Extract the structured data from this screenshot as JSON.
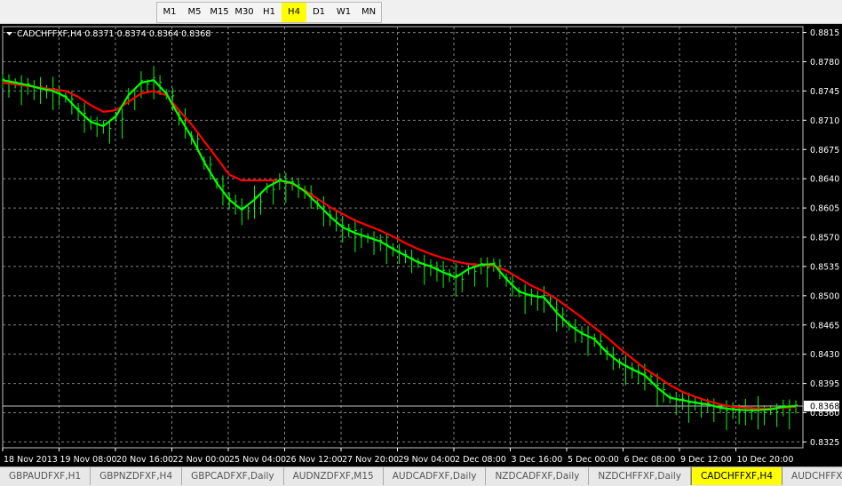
{
  "toolbar": {
    "timeframes": [
      {
        "label": "M1",
        "active": false
      },
      {
        "label": "M5",
        "active": false
      },
      {
        "label": "M15",
        "active": false
      },
      {
        "label": "M30",
        "active": false
      },
      {
        "label": "H1",
        "active": false
      },
      {
        "label": "H4",
        "active": true
      },
      {
        "label": "D1",
        "active": false
      },
      {
        "label": "W1",
        "active": false
      },
      {
        "label": "MN",
        "active": false
      }
    ]
  },
  "chart": {
    "header": "CADCHFFXF,H4  0.8371 0.8374 0.8364 0.8368",
    "current_price": "0.8368",
    "colors": {
      "background": "#000000",
      "grid": "#808080",
      "bars": "#00ff00",
      "ma_fast": "#00ff00",
      "ma_slow": "#ff0000",
      "price_line": "#c0c0c0"
    }
  },
  "chart_data": {
    "type": "line",
    "y_ticks": [
      "0.8815",
      "0.8780",
      "0.8745",
      "0.8710",
      "0.8675",
      "0.8640",
      "0.8605",
      "0.8570",
      "0.8535",
      "0.8500",
      "0.8465",
      "0.8430",
      "0.8395",
      "0.8360",
      "0.8325"
    ],
    "x_ticks": [
      "18 Nov 2013",
      "19 Nov 08:00",
      "20 Nov 16:00",
      "22 Nov 00:00",
      "25 Nov 04:00",
      "26 Nov 12:00",
      "27 Nov 20:00",
      "29 Nov 04:00",
      "2 Dec 08:00",
      "3 Dec 16:00",
      "5 Dec 00:00",
      "6 Dec 08:00",
      "9 Dec 12:00",
      "10 Dec 20:00"
    ],
    "ylim": [
      0.8318,
      0.8822
    ],
    "grid": true,
    "series": [
      {
        "values": [
          0.8758,
          0.8755,
          0.8752,
          0.8748,
          0.8745,
          0.8738,
          0.8722,
          0.8708,
          0.8703,
          0.8715,
          0.874,
          0.8755,
          0.8758,
          0.8742,
          0.8715,
          0.869,
          0.866,
          0.8635,
          0.8615,
          0.8603,
          0.8615,
          0.863,
          0.8638,
          0.8635,
          0.8625,
          0.861,
          0.8595,
          0.8582,
          0.8575,
          0.857,
          0.8565,
          0.8556,
          0.8548,
          0.854,
          0.8535,
          0.8528,
          0.8522,
          0.8532,
          0.8537,
          0.8538,
          0.852,
          0.8505,
          0.85,
          0.8498,
          0.848,
          0.8465,
          0.8455,
          0.8448,
          0.8432,
          0.842,
          0.8412,
          0.8405,
          0.839,
          0.8378,
          0.8375,
          0.8372,
          0.837,
          0.8366,
          0.8364,
          0.8363,
          0.8363,
          0.8364,
          0.8367,
          0.8368
        ]
      },
      {
        "values": [
          0.8755,
          0.8753,
          0.8751,
          0.8749,
          0.8747,
          0.8745,
          0.8738,
          0.8728,
          0.872,
          0.8722,
          0.8732,
          0.8742,
          0.8745,
          0.874,
          0.8722,
          0.8705,
          0.8685,
          0.8665,
          0.8645,
          0.8638,
          0.8638,
          0.8638,
          0.8638,
          0.8634,
          0.8626,
          0.8616,
          0.8606,
          0.8598,
          0.859,
          0.8584,
          0.8578,
          0.8571,
          0.8563,
          0.8556,
          0.855,
          0.8545,
          0.8541,
          0.8538,
          0.8537,
          0.8536,
          0.853,
          0.8521,
          0.8512,
          0.8505,
          0.8496,
          0.8485,
          0.8474,
          0.8462,
          0.845,
          0.8437,
          0.8425,
          0.8413,
          0.8403,
          0.8393,
          0.8385,
          0.8379,
          0.8374,
          0.837,
          0.8367,
          0.8366,
          0.8365,
          0.8365,
          0.8366,
          0.8367
        ]
      }
    ]
  },
  "tabs": [
    {
      "label": "GBPAUDFXF,H1",
      "active": false
    },
    {
      "label": "GBPNZDFXF,H4",
      "active": false
    },
    {
      "label": "GBPCADFXF,Daily",
      "active": false
    },
    {
      "label": "AUDNZDFXF,M15",
      "active": false
    },
    {
      "label": "AUDCADFXF,Daily",
      "active": false
    },
    {
      "label": "NZDCADFXF,Daily",
      "active": false
    },
    {
      "label": "NZDCHFFXF,Daily",
      "active": false
    },
    {
      "label": "CADCHFFXF,H4",
      "active": true
    },
    {
      "label": "AUDCHFFXF,Mo",
      "active": false
    }
  ]
}
